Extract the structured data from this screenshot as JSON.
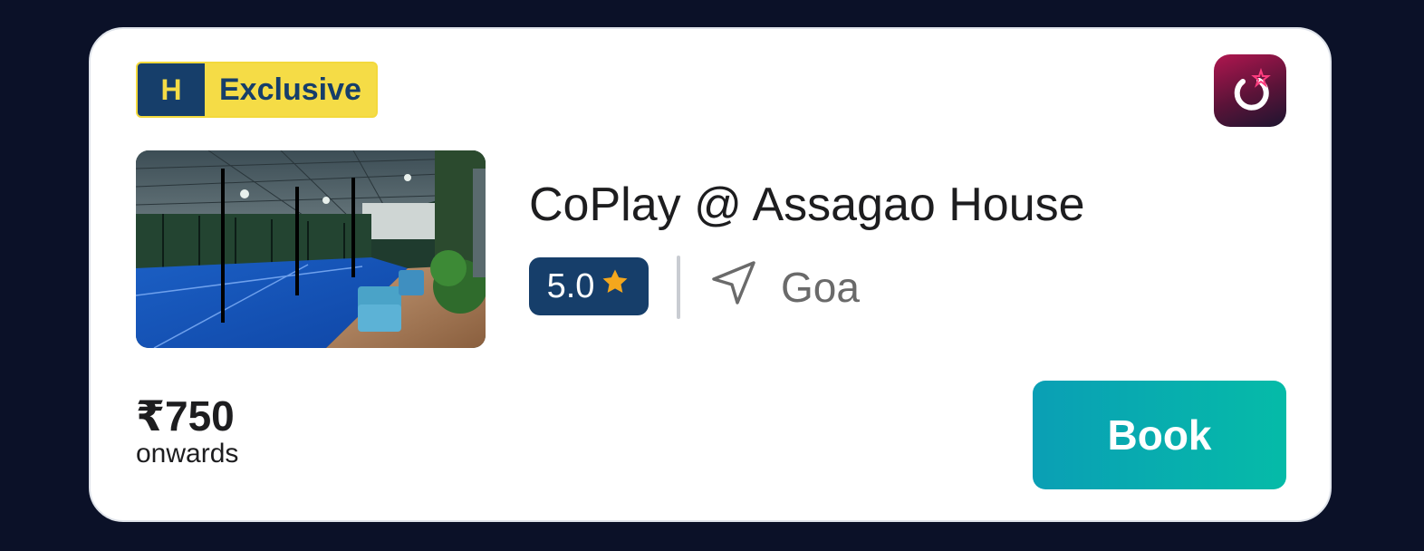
{
  "badge": {
    "letter": "H",
    "label": "Exclusive"
  },
  "venue": {
    "name": "CoPlay @ Assagao House",
    "rating": "5.0",
    "location": "Goa"
  },
  "pricing": {
    "amount": "₹750",
    "suffix": "onwards"
  },
  "actions": {
    "book_label": "Book"
  },
  "icons": {
    "rating": "star-icon",
    "location": "navigation-arrow-icon",
    "app": "app-logo-icon"
  },
  "colors": {
    "background": "#0b1128",
    "card": "#ffffff",
    "badge_yellow": "#f5dc46",
    "navy": "#163e6a",
    "star": "#f4a71d",
    "button_start": "#0a9fb5",
    "button_end": "#05bba8",
    "logo_accent": "#b0164f"
  }
}
